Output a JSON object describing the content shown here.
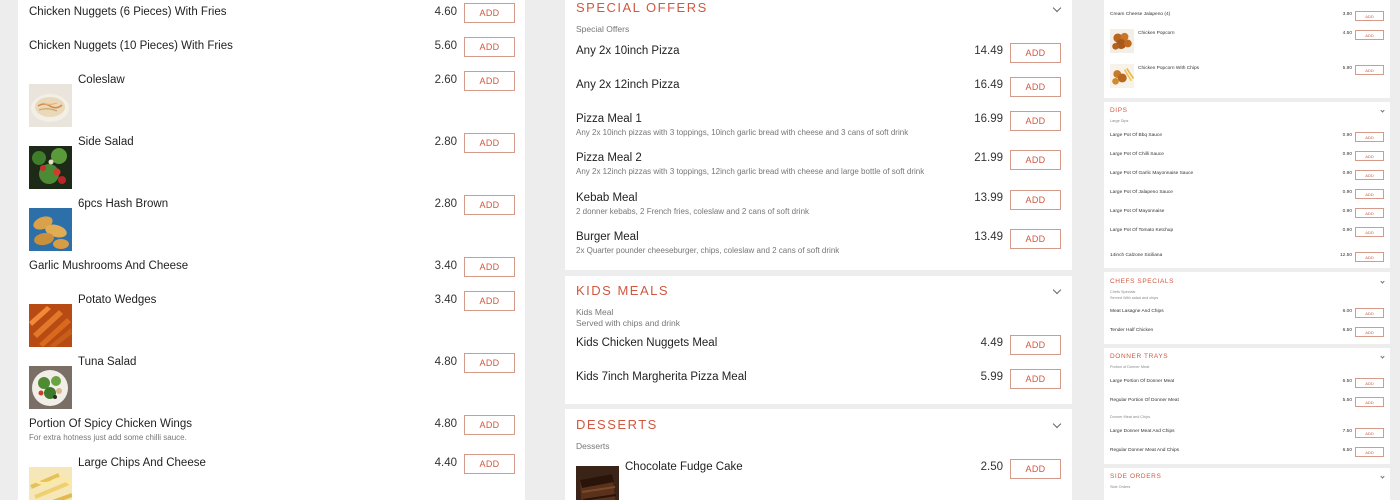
{
  "add_label": "ADD",
  "accent_color": "#d05840",
  "left": {
    "items": [
      {
        "name": "Chicken Nuggets (6 Pieces) With Fries",
        "price": "4.60"
      },
      {
        "name": "Chicken Nuggets (10 Pieces) With Fries",
        "price": "5.60"
      },
      {
        "name": "Coleslaw",
        "price": "2.60",
        "image": "coleslaw"
      },
      {
        "name": "Side Salad",
        "price": "2.80",
        "image": "side-salad"
      },
      {
        "name": "6pcs Hash Brown",
        "price": "2.80",
        "image": "hash-brown"
      },
      {
        "name": "Garlic Mushrooms And Cheese",
        "price": "3.40"
      },
      {
        "name": "Potato Wedges",
        "price": "3.40",
        "image": "potato-wedges"
      },
      {
        "name": "Tuna Salad",
        "price": "4.80",
        "image": "tuna-salad"
      },
      {
        "name": "Portion Of Spicy Chicken Wings",
        "price": "4.80",
        "desc": "For extra hotness just add some chilli sauce."
      },
      {
        "name": "Large Chips And Cheese",
        "price": "4.40",
        "image": "chips-cheese"
      }
    ]
  },
  "middle": {
    "special": {
      "title": "SPECIAL OFFERS",
      "sub": "Special Offers",
      "items": [
        {
          "name": "Any 2x 10inch Pizza",
          "price": "14.49"
        },
        {
          "name": "Any 2x 12inch Pizza",
          "price": "16.49"
        },
        {
          "name": "Pizza Meal 1",
          "price": "16.99",
          "desc": "Any 2x 10inch pizzas with 3 toppings, 10inch garlic bread with cheese and 3 cans of soft drink"
        },
        {
          "name": "Pizza Meal 2",
          "price": "21.99",
          "desc": "Any 2x 12inch pizzas with 3 toppings, 12inch garlic bread with cheese and large bottle of soft drink"
        },
        {
          "name": "Kebab Meal",
          "price": "13.99",
          "desc": "2 donner kebabs, 2 French fries, coleslaw and 2 cans of soft drink"
        },
        {
          "name": "Burger Meal",
          "price": "13.49",
          "desc": "2x Quarter pounder cheeseburger, chips, coleslaw and 2 cans of soft drink"
        }
      ]
    },
    "kids": {
      "title": "KIDS MEALS",
      "sub": "Kids Meal",
      "sub2": "Served with chips and drink",
      "items": [
        {
          "name": "Kids Chicken Nuggets Meal",
          "price": "4.49"
        },
        {
          "name": "Kids 7inch Margherita Pizza Meal",
          "price": "5.99"
        }
      ]
    },
    "desserts": {
      "title": "DESSERTS",
      "sub": "Desserts",
      "items": [
        {
          "name": "Chocolate Fudge Cake",
          "price": "2.50",
          "image": "fudge-cake"
        }
      ]
    }
  },
  "right": {
    "top_items": [
      {
        "name": "Cream Cheese Jalapeno (4)",
        "price": "3.80"
      },
      {
        "name": "Chicken Popcorn",
        "price": "4.50",
        "image": "popcorn"
      },
      {
        "name": "Chicken Popcorn With Chips",
        "price": "5.90",
        "image": "popcorn-chips"
      }
    ],
    "dips": {
      "title": "DIPS",
      "sub": "Large Dips",
      "items": [
        {
          "name": "Large Pot Of Bbq Sauce",
          "price": "0.90"
        },
        {
          "name": "Large Pot Of Chilli Sauce",
          "price": "0.90"
        },
        {
          "name": "Large Pot Of Garlic Mayonnaise Sauce",
          "price": "0.90"
        },
        {
          "name": "Large Pot Of Jalapeno Sauce",
          "price": "0.90"
        },
        {
          "name": "Large Pot Of Mayonnaise",
          "price": "0.90"
        },
        {
          "name": "Large Pot Of Tomato Ketchup",
          "price": "0.90"
        }
      ]
    },
    "calzone": {
      "name": "14inch Calzone Siciliana",
      "price": "12.50"
    },
    "chefs": {
      "title": "CHEFS SPECIALS",
      "sub": "Chefs Specials",
      "sub2": "Served With salad and chips",
      "items": [
        {
          "name": "Meat Lasagne And Chips",
          "price": "6.00"
        },
        {
          "name": "Tender Half Chicken",
          "price": "6.50"
        }
      ]
    },
    "donner": {
      "title": "DONNER TRAYS",
      "sub": "Portion of Donner Meat",
      "items": [
        {
          "name": "Large Portion Of Donner Meat",
          "price": "6.50"
        },
        {
          "name": "Regular Portion Of Donner Meat",
          "price": "5.50"
        }
      ],
      "sub2": "Donner Meat and Chips",
      "items2": [
        {
          "name": "Large Donner Meat And Chips",
          "price": "7.50"
        },
        {
          "name": "Regular Donner Meat And Chips",
          "price": "6.50"
        }
      ]
    },
    "side": {
      "title": "SIDE ORDERS",
      "sub": "Side Orders"
    }
  }
}
